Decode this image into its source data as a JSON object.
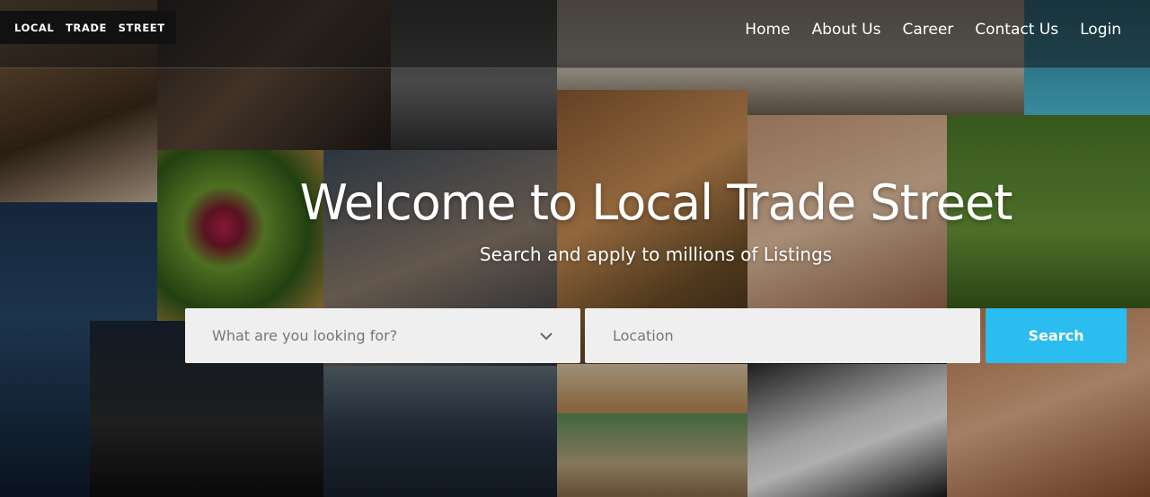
{
  "brand": {
    "logo_text": "LOCAL TRADE STREET"
  },
  "nav": {
    "items": [
      "Home",
      "About Us",
      "Career",
      "Contact Us",
      "Login"
    ]
  },
  "hero": {
    "title": "Welcome to Local Trade Street",
    "subtitle": "Search and apply to millions of Listings"
  },
  "search": {
    "category_placeholder": "What are you looking for?",
    "location_placeholder": "Location",
    "button_label": "Search"
  },
  "colors": {
    "accent": "#2bbcf0",
    "field_bg": "#efefef"
  }
}
